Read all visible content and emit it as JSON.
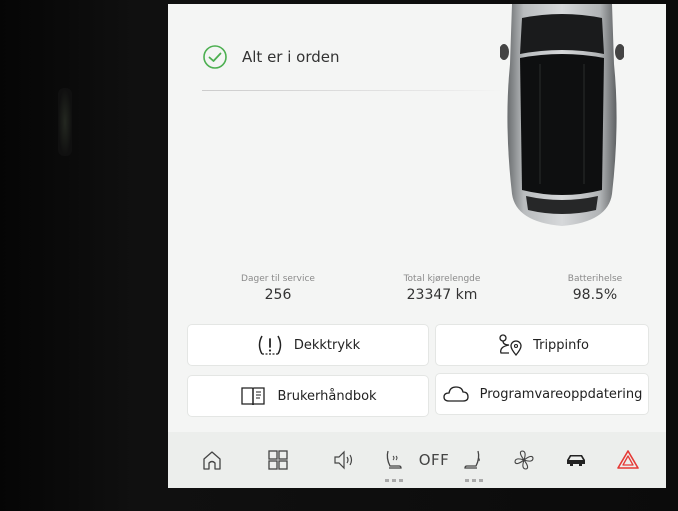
{
  "status": {
    "message": "Alt er i orden",
    "icon": "check-circle-icon",
    "icon_color": "#4caf50"
  },
  "stats": {
    "service": {
      "label": "Dager til service",
      "value": "256"
    },
    "odometer": {
      "label": "Total kjørelengde",
      "value": "23347 km"
    },
    "battery": {
      "label": "Batterihelse",
      "value": "98.5%"
    }
  },
  "buttons": {
    "tire_pressure": {
      "label": "Dekktrykk",
      "icon": "tire-pressure-warning-icon"
    },
    "trip_info": {
      "label": "Trippinfo",
      "icon": "route-icon"
    },
    "manual": {
      "label": "Brukerhåndbok",
      "icon": "book-icon"
    },
    "software_update": {
      "label": "Programvareoppdatering",
      "icon": "cloud-icon"
    }
  },
  "taskbar": {
    "items": [
      {
        "name": "home",
        "icon": "home-icon"
      },
      {
        "name": "apps",
        "icon": "app-grid-icon"
      },
      {
        "name": "volume",
        "icon": "speaker-icon"
      },
      {
        "name": "seat-heat-driver",
        "icon": "seat-heat-icon"
      },
      {
        "name": "climate",
        "label": "OFF"
      },
      {
        "name": "seat-heat-passenger",
        "icon": "seat-icon"
      },
      {
        "name": "fan",
        "icon": "fan-icon"
      },
      {
        "name": "car",
        "icon": "car-icon"
      },
      {
        "name": "hazard",
        "icon": "hazard-triangle-icon"
      }
    ],
    "hazard_color": "#e53935",
    "active_color": "#222222"
  }
}
